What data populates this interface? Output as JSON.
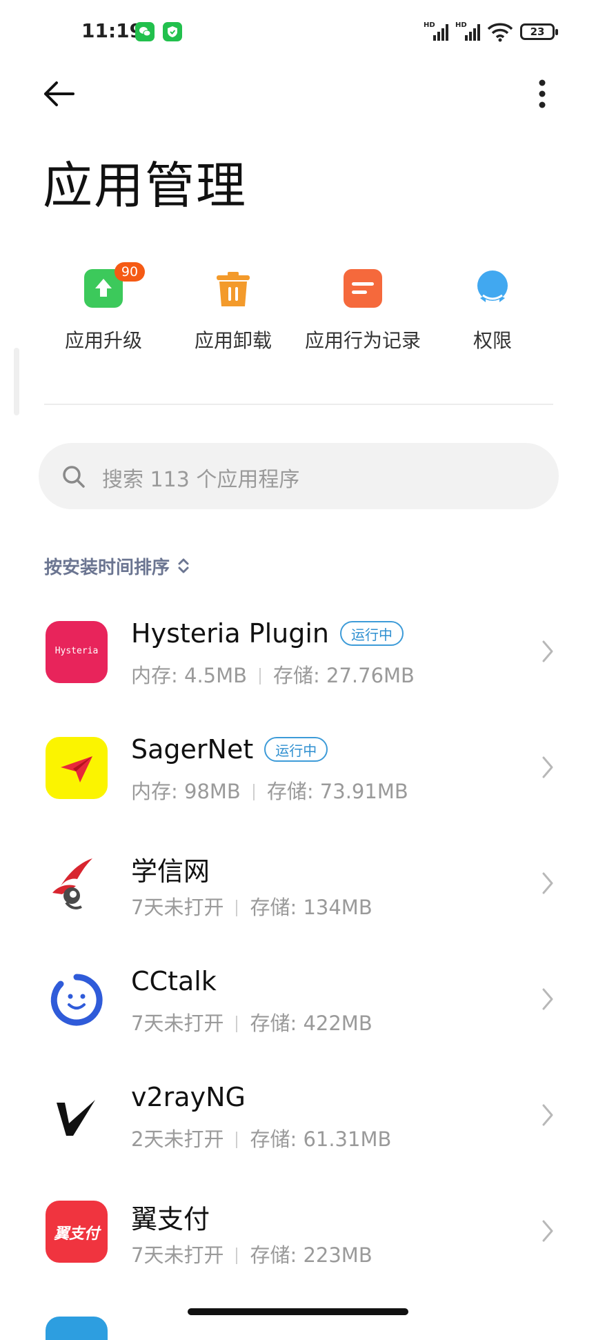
{
  "status_bar": {
    "time": "11:19",
    "battery": "23",
    "hd1": "HD",
    "hd2": "HD"
  },
  "header": {
    "title": "应用管理"
  },
  "quick_actions": [
    {
      "label": "应用升级",
      "badge": "90",
      "color": "#3cc95b"
    },
    {
      "label": "应用卸载",
      "color": "#f39a2b"
    },
    {
      "label": "应用行为记录",
      "color": "#f5693c"
    },
    {
      "label": "权限",
      "color": "#41a8f0"
    }
  ],
  "search": {
    "placeholder": "搜索 113 个应用程序"
  },
  "sort": {
    "label": "按安装时间排序"
  },
  "apps": [
    {
      "name": "Hysteria Plugin",
      "badge": "运行中",
      "meta1": "内存: 4.5MB",
      "meta2": "存储: 27.76MB",
      "icon_text": "Hysteria",
      "icon_color": "#e8245b"
    },
    {
      "name": "SagerNet",
      "badge": "运行中",
      "meta1": "内存: 98MB",
      "meta2": "存储: 73.91MB",
      "icon_color": "#fbf400"
    },
    {
      "name": "学信网",
      "meta1": "7天未打开",
      "meta2": "存储: 134MB",
      "icon_color": "#ffffff"
    },
    {
      "name": "CCtalk",
      "meta1": "7天未打开",
      "meta2": "存储: 422MB",
      "icon_color": "#ffffff"
    },
    {
      "name": "v2rayNG",
      "meta1": "2天未打开",
      "meta2": "存储: 61.31MB",
      "icon_color": "#ffffff"
    },
    {
      "name": "翼支付",
      "meta1": "7天未打开",
      "meta2": "存储: 223MB",
      "icon_text": "翼支付",
      "icon_color": "#f0343f"
    }
  ]
}
